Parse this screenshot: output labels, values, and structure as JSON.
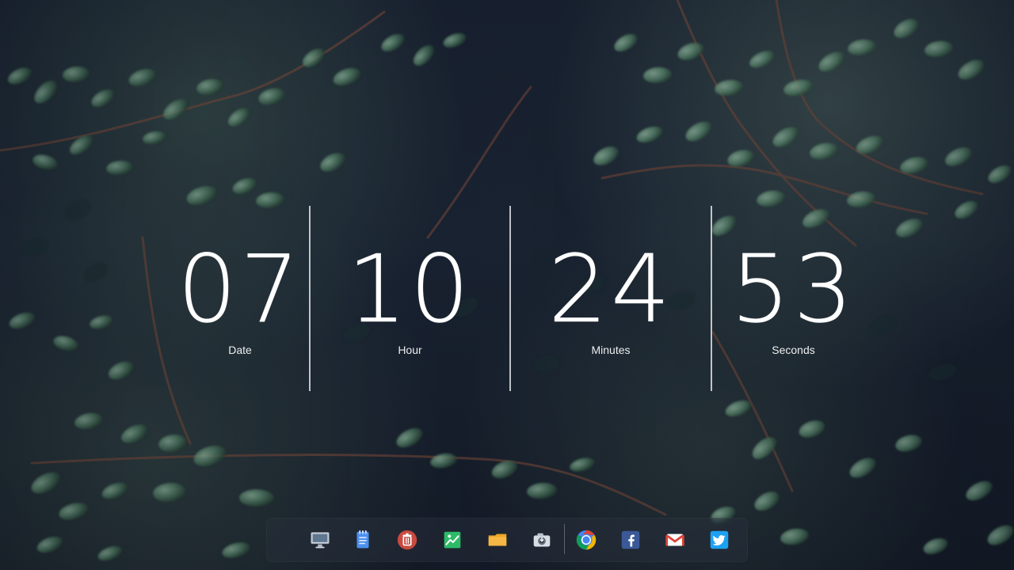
{
  "clock": {
    "date": {
      "value": "07",
      "label": "Date"
    },
    "hour": {
      "value": "10",
      "label": "Hour"
    },
    "minutes": {
      "value": "24",
      "label": "Minutes"
    },
    "seconds": {
      "value": "53",
      "label": "Seconds"
    }
  },
  "dock": {
    "items": [
      {
        "icon": "monitor-icon"
      },
      {
        "icon": "notes-icon"
      },
      {
        "icon": "trash-icon"
      },
      {
        "icon": "image-viewer-icon"
      },
      {
        "icon": "folder-icon"
      },
      {
        "icon": "camera-icon"
      },
      {
        "icon": "chrome-icon"
      },
      {
        "icon": "facebook-icon"
      },
      {
        "icon": "gmail-icon"
      },
      {
        "icon": "twitter-icon"
      }
    ]
  },
  "colors": {
    "clock_text": "#ffffff",
    "separator": "#e8edf2",
    "dock_background": "#2a313d",
    "facebook_blue": "#3b5998",
    "twitter_blue": "#1da1f2",
    "chrome_red": "#db4437",
    "chrome_yellow": "#f4b400",
    "chrome_green": "#0f9d58",
    "chrome_blue": "#4285f4",
    "trash_red": "#c94a3f",
    "folder_orange": "#f3a229",
    "notes_blue": "#4b8ff2",
    "image_green": "#2dbb67",
    "monitor_gray": "#cfd6df"
  }
}
